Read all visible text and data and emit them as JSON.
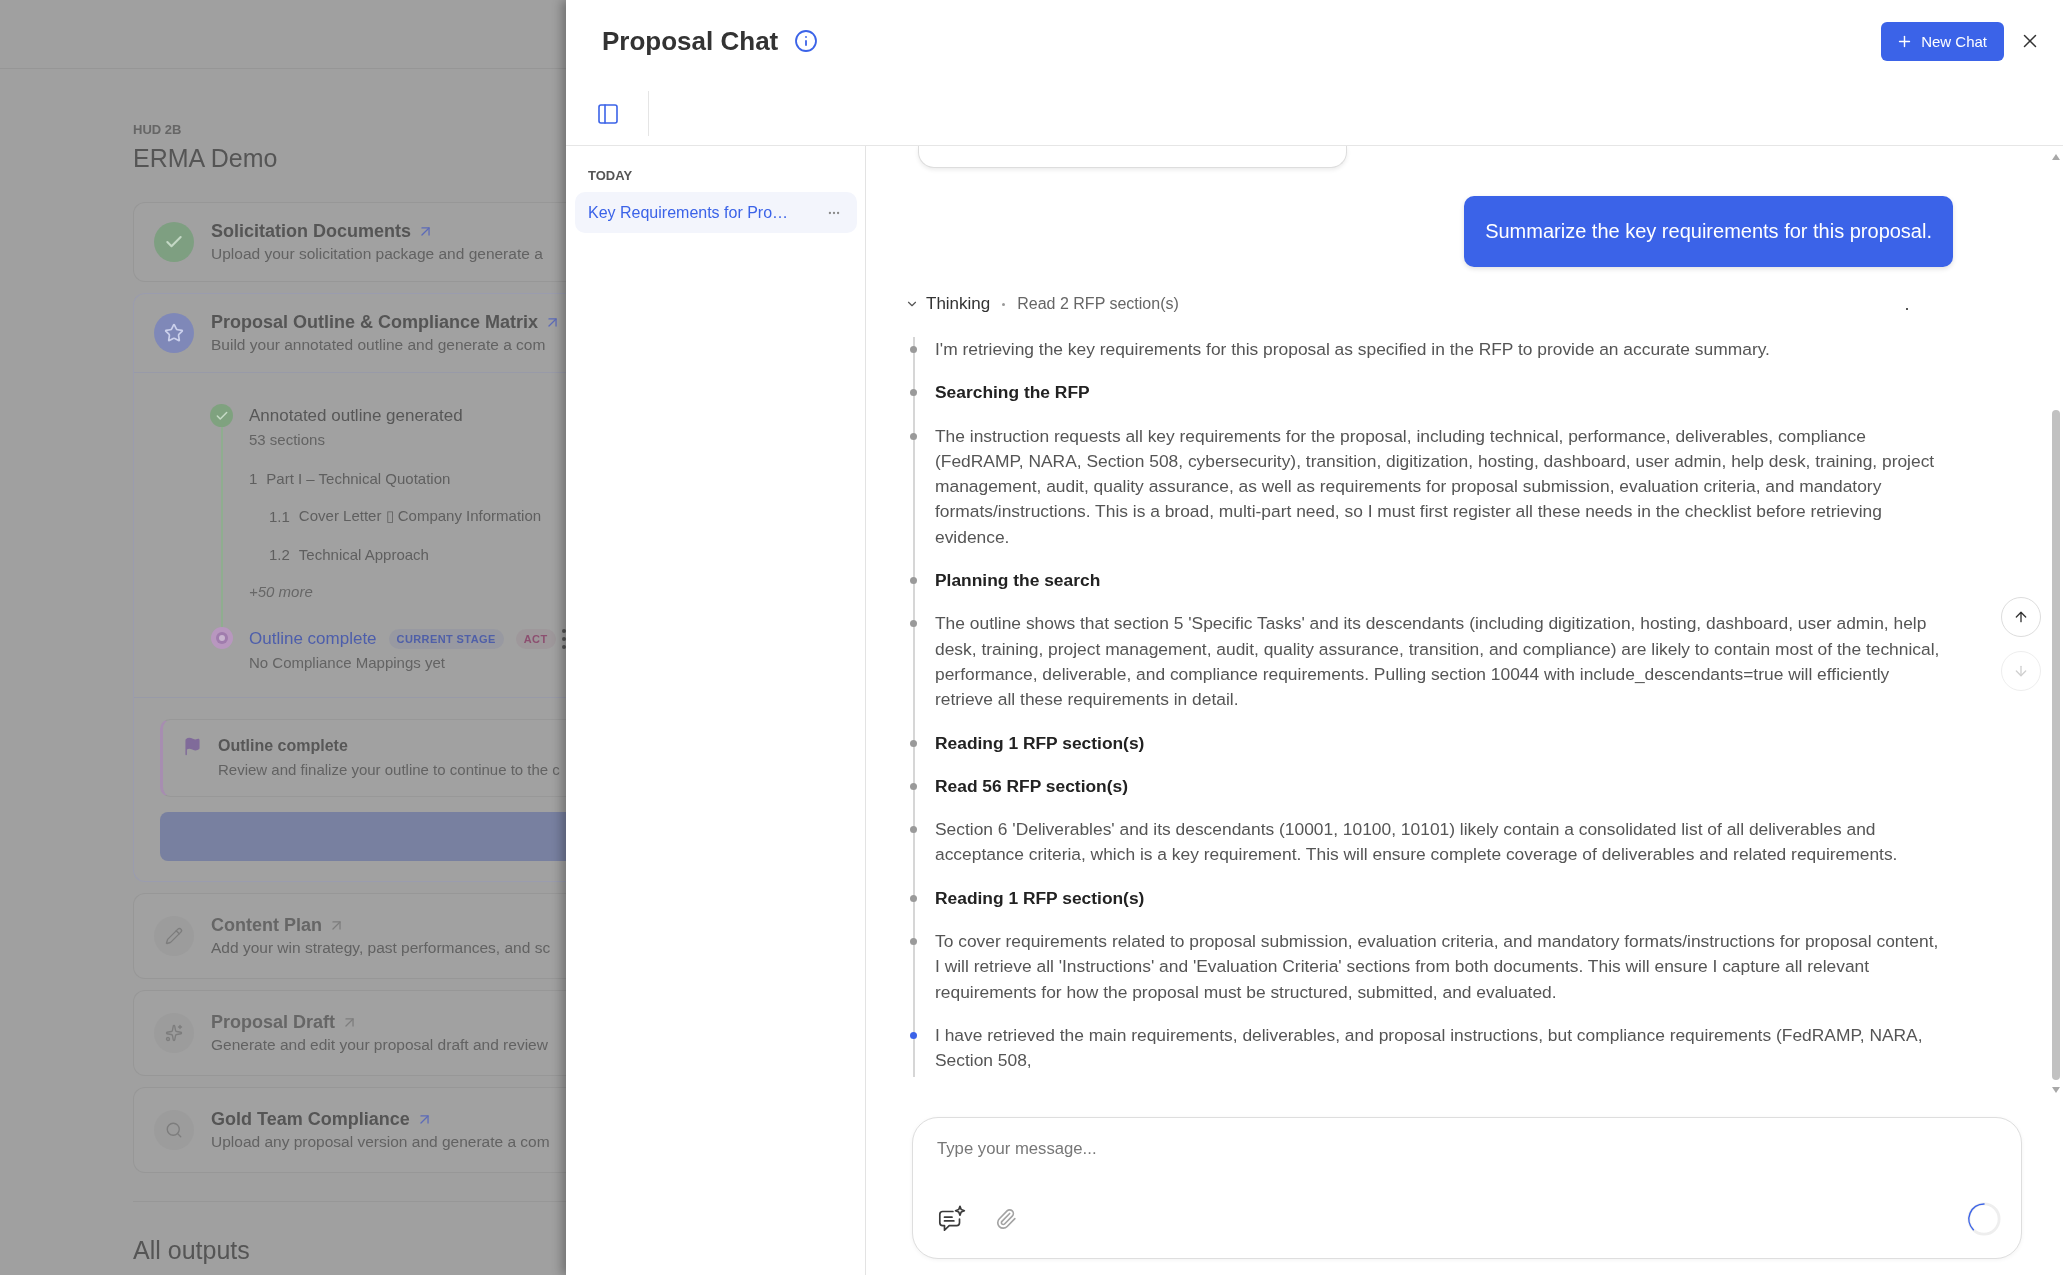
{
  "background_page": {
    "project_code": "HUD 2B",
    "title": "ERMA Demo",
    "stages": [
      {
        "kind": "done",
        "title": "Solicitation Documents",
        "description": "Upload your solicitation package and generate a",
        "disabled": false
      },
      {
        "kind": "current",
        "title": "Proposal Outline & Compliance Matrix",
        "description": "Build your annotated outline and generate a com",
        "disabled": false,
        "steps": [
          {
            "kind": "done",
            "title": "Annotated outline generated",
            "detail": "53 sections",
            "outline": [
              {
                "number": "1",
                "title": "Part I – Technical Quotation",
                "children": [
                  {
                    "number": "1.1",
                    "title": "Cover Letter ▯ Company Information"
                  },
                  {
                    "number": "1.2",
                    "title": "Technical Approach"
                  }
                ]
              }
            ],
            "more": "+50 more"
          },
          {
            "kind": "current",
            "title": "Outline complete",
            "badges": [
              {
                "label": "CURRENT STAGE",
                "color": "#4f5fa8"
              },
              {
                "label": "ACT",
                "color": "#8c4f70"
              }
            ],
            "detail": "No Compliance Mappings yet"
          }
        ],
        "notice": {
          "title": "Outline complete",
          "text": "Review and finalize your outline to continue to the c"
        }
      },
      {
        "kind": "pending",
        "title": "Content Plan",
        "description": "Add your win strategy, past performances, and sc",
        "disabled": true
      },
      {
        "kind": "pending",
        "title": "Proposal Draft",
        "description": "Generate and edit your proposal draft and review",
        "disabled": true
      },
      {
        "kind": "pending",
        "title": "Gold Team Compliance",
        "description": "Upload any proposal version and generate a com",
        "disabled": false
      }
    ],
    "section_heading": "All outputs"
  },
  "chat_panel": {
    "title": "Proposal Chat",
    "new_chat_button": "New Chat",
    "history": {
      "groups": [
        {
          "label": "TODAY",
          "items": [
            {
              "title": "Key Requirements for Pro…",
              "selected": true
            }
          ]
        }
      ]
    },
    "conversation": {
      "user_message": "Summarize the key requirements for this proposal.",
      "thinking": {
        "label": "Thinking",
        "summary": "Read 2 RFP section(s)",
        "expanded": true,
        "steps": [
          {
            "kind": "text",
            "text": "I'm retrieving the key requirements for this proposal as specified in the RFP to provide an accurate summary.",
            "active": false
          },
          {
            "kind": "heading",
            "text": "Searching the RFP",
            "active": false
          },
          {
            "kind": "text",
            "text": "The instruction requests all key requirements for the proposal, including technical, performance, deliverables, compliance (FedRAMP, NARA, Section 508, cybersecurity), transition, digitization, hosting, dashboard, user admin, help desk, training, project management, audit, quality assurance, as well as requirements for proposal submission, evaluation criteria, and mandatory formats/instructions. This is a broad, multi-part need, so I must first register all these needs in the checklist before retrieving evidence.",
            "active": false
          },
          {
            "kind": "heading",
            "text": "Planning the search",
            "active": false
          },
          {
            "kind": "text",
            "text": "The outline shows that section 5 'Specific Tasks' and its descendants (including digitization, hosting, dashboard, user admin, help desk, training, project management, audit, quality assurance, transition, and compliance) are likely to contain most of the technical, performance, deliverable, and compliance requirements. Pulling section 10044 with include_descendants=true will efficiently retrieve all these requirements in detail.",
            "active": false
          },
          {
            "kind": "heading",
            "text": "Reading 1 RFP section(s)",
            "active": false
          },
          {
            "kind": "heading",
            "text": "Read 56 RFP section(s)",
            "active": false
          },
          {
            "kind": "text",
            "text": "Section 6 'Deliverables' and its descendants (10001, 10100, 10101) likely contain a consolidated list of all deliverables and acceptance criteria, which is a key requirement. This will ensure complete coverage of deliverables and related requirements.",
            "active": false
          },
          {
            "kind": "heading",
            "text": "Reading 1 RFP section(s)",
            "active": false
          },
          {
            "kind": "text",
            "text": "To cover requirements related to proposal submission, evaluation criteria, and mandatory formats/instructions for proposal content, I will retrieve all 'Instructions' and 'Evaluation Criteria' sections from both documents. This will ensure I capture all relevant requirements for how the proposal must be structured, submitted, and evaluated.",
            "active": false
          },
          {
            "kind": "text",
            "text": "I have retrieved the main requirements, deliverables, and proposal instructions, but compliance requirements (FedRAMP, NARA, Section 508,",
            "active": true
          }
        ]
      }
    },
    "scroll_buttons": [
      {
        "kind": "up",
        "disabled": false
      },
      {
        "kind": "down",
        "disabled": true
      }
    ],
    "composer": {
      "placeholder": "Type your message..."
    }
  }
}
